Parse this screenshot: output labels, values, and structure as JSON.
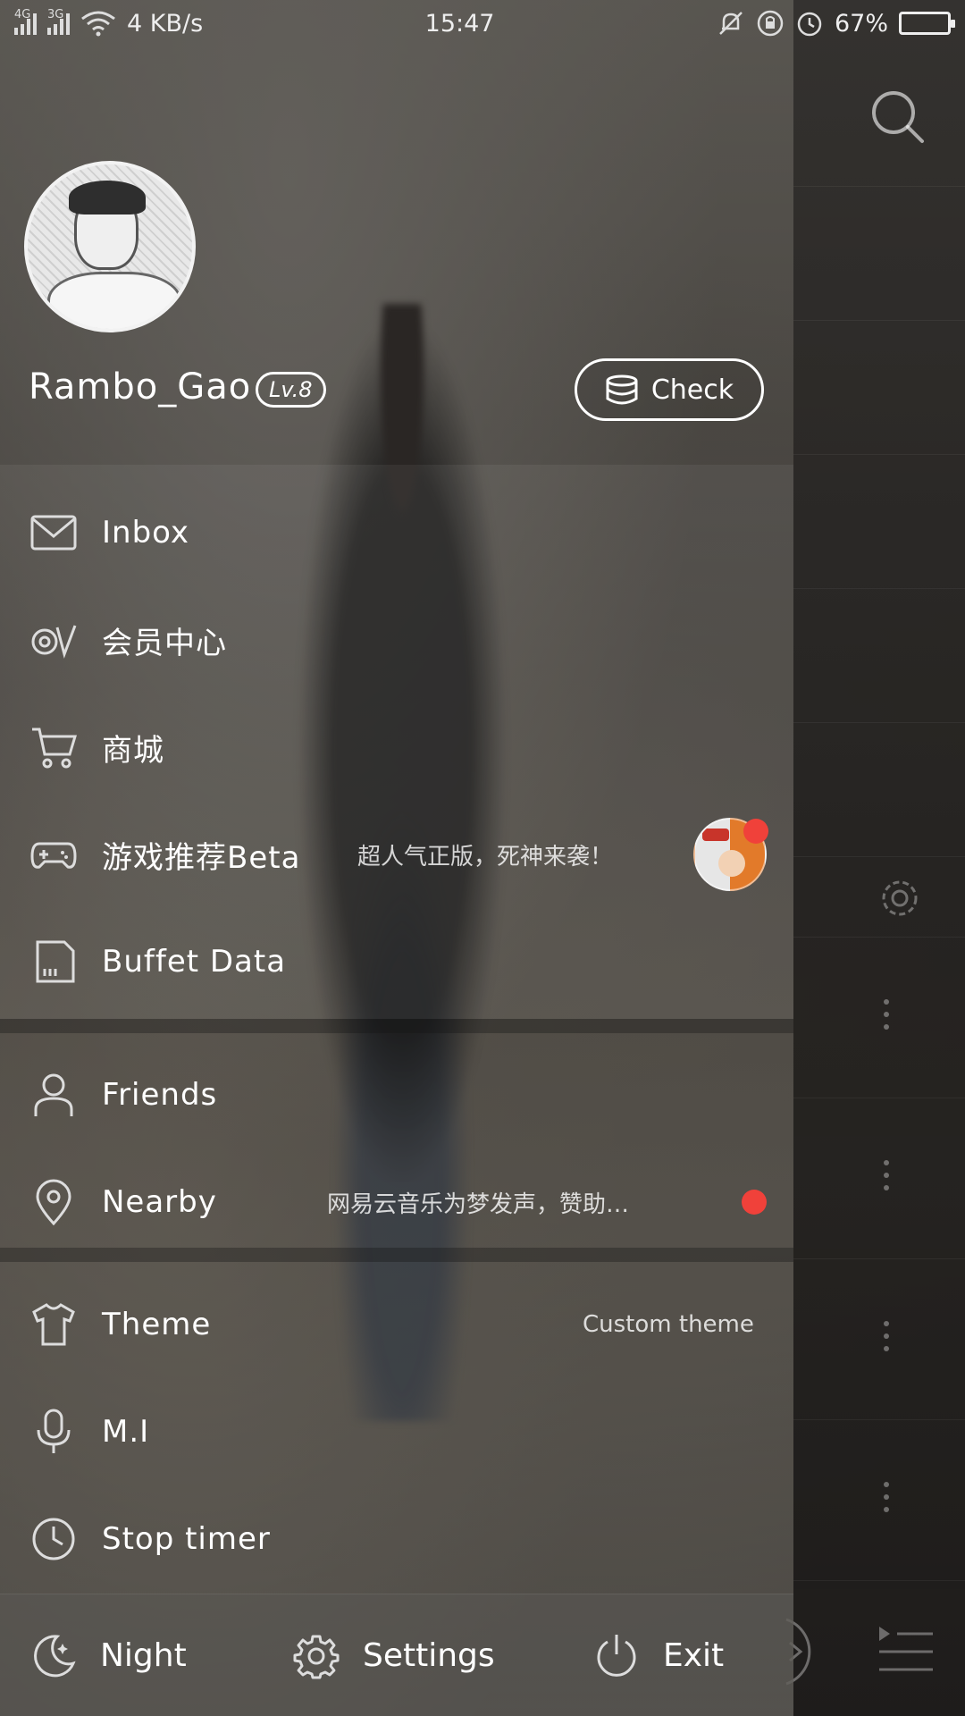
{
  "status_bar": {
    "net_left": "4G",
    "net_right": "3G",
    "speed": "4 KB/s",
    "time": "15:47",
    "battery": "67%",
    "battery_level": 0.67
  },
  "profile": {
    "username": "Rambo_Gao",
    "level": "Lv.8",
    "check_label": "Check"
  },
  "menu": {
    "inbox": "Inbox",
    "vip": "会员中心",
    "store": "商城",
    "games": "游戏推荐Beta",
    "games_sub": "超人气正版，死神来袭！",
    "buffet": "Buffet Data",
    "friends": "Friends",
    "nearby": "Nearby",
    "nearby_sub": "网易云音乐为梦发声，赞助…",
    "theme": "Theme",
    "theme_sub": "Custom theme",
    "mi": "M.I",
    "timer": "Stop timer"
  },
  "bottom": {
    "night": "Night",
    "settings": "Settings",
    "exit": "Exit"
  },
  "icons": {
    "inbox": "mail-icon",
    "vip": "vip-icon",
    "store": "cart-icon",
    "games": "gamepad-icon",
    "buffet": "sim-card-icon",
    "friends": "person-icon",
    "nearby": "location-pin-icon",
    "theme": "tshirt-icon",
    "mi": "microphone-icon",
    "timer": "clock-icon",
    "night": "moon-icon",
    "settings": "gear-icon",
    "exit": "power-icon"
  },
  "colors": {
    "badge_red": "#f0413a"
  }
}
